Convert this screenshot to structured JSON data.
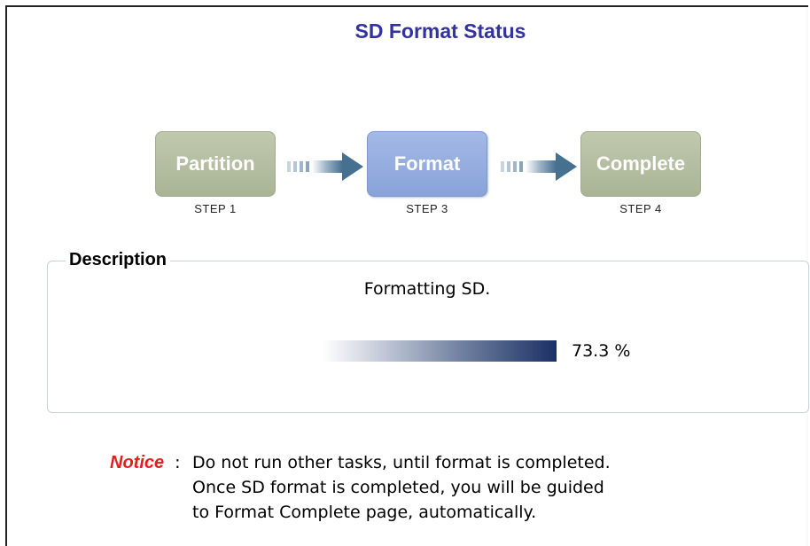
{
  "page": {
    "title": "SD Format Status"
  },
  "steps": [
    {
      "label": "Partition",
      "caption": "STEP 1",
      "state": "done"
    },
    {
      "label": "Format",
      "caption": "STEP 3",
      "state": "active"
    },
    {
      "label": "Complete",
      "caption": "STEP 4",
      "state": "done"
    }
  ],
  "description": {
    "legend": "Description",
    "status_text": "Formatting SD.",
    "progress_value": 73.3,
    "progress_text": "73.3 %"
  },
  "notice": {
    "label": "Notice",
    "separator": ":",
    "lines": [
      "Do not run other tasks, until format is completed.",
      "Once SD format is completed, you will be guided",
      "to Format Complete page, automatically."
    ]
  },
  "colors": {
    "title": "#33339f",
    "step_done": "#b4bea2",
    "step_active": "#93acdf",
    "progress_end": "#1b3065",
    "notice_label": "#e51d1d",
    "arrow": "#4f7595"
  },
  "icons": {
    "arrow": "right-arrow-icon"
  }
}
